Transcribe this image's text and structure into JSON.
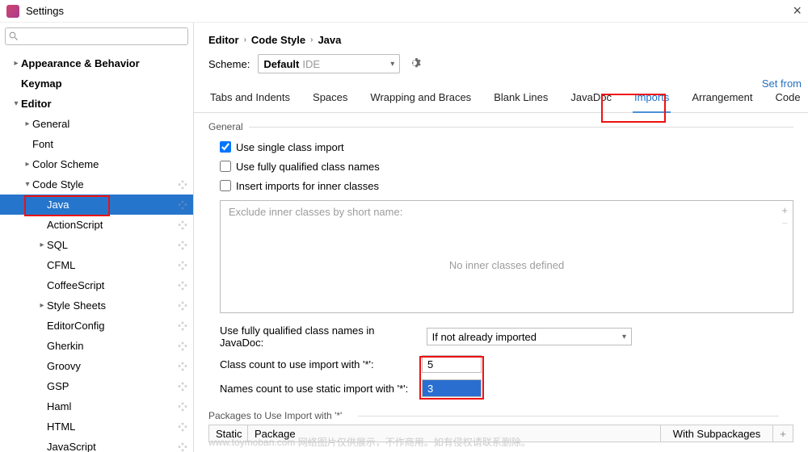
{
  "window": {
    "title": "Settings"
  },
  "search": {
    "placeholder": ""
  },
  "sidebar": {
    "items": [
      {
        "label": "Appearance & Behavior",
        "bold": true,
        "arrow": "right",
        "indent": 1
      },
      {
        "label": "Keymap",
        "bold": true,
        "arrow": "",
        "indent": 1
      },
      {
        "label": "Editor",
        "bold": true,
        "arrow": "down",
        "indent": 1
      },
      {
        "label": "General",
        "arrow": "right",
        "indent": 2
      },
      {
        "label": "Font",
        "arrow": "",
        "indent": 2
      },
      {
        "label": "Color Scheme",
        "arrow": "right",
        "indent": 2
      },
      {
        "label": "Code Style",
        "arrow": "down",
        "indent": 2,
        "repo": true
      },
      {
        "label": "Java",
        "arrow": "",
        "indent": 3,
        "repo": true,
        "selected": true
      },
      {
        "label": "ActionScript",
        "arrow": "",
        "indent": 3,
        "repo": true
      },
      {
        "label": "SQL",
        "arrow": "right",
        "indent": 3,
        "repo": true
      },
      {
        "label": "CFML",
        "arrow": "",
        "indent": 3,
        "repo": true
      },
      {
        "label": "CoffeeScript",
        "arrow": "",
        "indent": 3,
        "repo": true
      },
      {
        "label": "Style Sheets",
        "arrow": "right",
        "indent": 3,
        "repo": true
      },
      {
        "label": "EditorConfig",
        "arrow": "",
        "indent": 3,
        "repo": true
      },
      {
        "label": "Gherkin",
        "arrow": "",
        "indent": 3,
        "repo": true
      },
      {
        "label": "Groovy",
        "arrow": "",
        "indent": 3,
        "repo": true
      },
      {
        "label": "GSP",
        "arrow": "",
        "indent": 3,
        "repo": true
      },
      {
        "label": "Haml",
        "arrow": "",
        "indent": 3,
        "repo": true
      },
      {
        "label": "HTML",
        "arrow": "",
        "indent": 3,
        "repo": true
      },
      {
        "label": "JavaScript",
        "arrow": "",
        "indent": 3,
        "repo": true
      }
    ]
  },
  "breadcrumb": [
    "Editor",
    "Code Style",
    "Java"
  ],
  "scheme": {
    "label": "Scheme:",
    "name": "Default",
    "hint": "IDE"
  },
  "setfrom": "Set from",
  "tabs": [
    "Tabs and Indents",
    "Spaces",
    "Wrapping and Braces",
    "Blank Lines",
    "JavaDoc",
    "Imports",
    "Arrangement",
    "Code"
  ],
  "active_tab": 5,
  "general": {
    "title": "General",
    "checks": [
      {
        "label": "Use single class import",
        "checked": true
      },
      {
        "label": "Use fully qualified class names",
        "checked": false
      },
      {
        "label": "Insert imports for inner classes",
        "checked": false
      }
    ],
    "exclude_hdr": "Exclude inner classes by short name:",
    "exclude_empty": "No inner classes defined"
  },
  "javadoc_fq": {
    "label": "Use fully qualified class names in JavaDoc:",
    "value": "If not already imported"
  },
  "class_count": {
    "label": "Class count to use import with '*':",
    "value": "5"
  },
  "names_count": {
    "label": "Names count to use static import with '*':",
    "value": "3"
  },
  "packages": {
    "title": "Packages to Use Import with '*'",
    "cols": [
      "Static",
      "Package",
      "With Subpackages"
    ]
  },
  "watermark": "www.toymoban.com  网络图片仅供展示，不作商用。如有侵权请联系删除。"
}
